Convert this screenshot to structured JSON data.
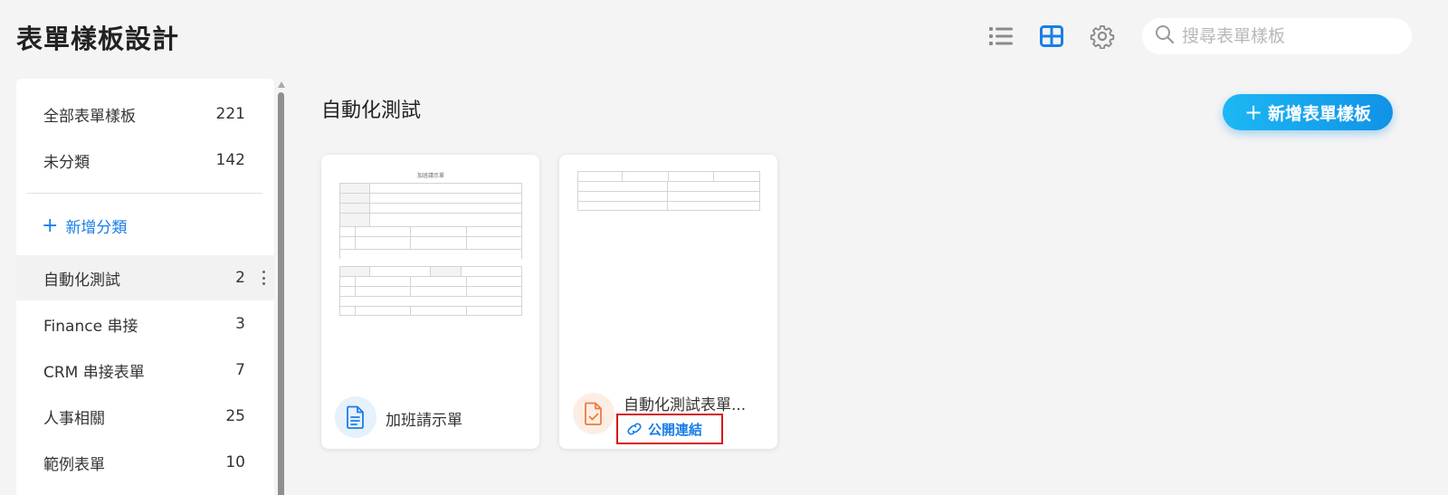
{
  "header": {
    "title": "表單樣板設計",
    "search_placeholder": "搜尋表單樣板",
    "icons": [
      "list-view-icon",
      "grid-view-icon",
      "gear-icon",
      "search-icon"
    ],
    "active_view_color": "#1a7ee8"
  },
  "sidebar": {
    "items": [
      {
        "label": "全部表單樣板",
        "count": "221"
      },
      {
        "label": "未分類",
        "count": "142"
      }
    ],
    "add_category_label": "新增分類",
    "categories": [
      {
        "label": "自動化測試",
        "count": "2"
      },
      {
        "label": "Finance 串接",
        "count": "3"
      },
      {
        "label": "CRM 串接表單",
        "count": "7"
      },
      {
        "label": "人事相關",
        "count": "25"
      },
      {
        "label": "範例表單",
        "count": "10"
      }
    ]
  },
  "main": {
    "section_title": "自動化測試",
    "add_button_label": "新增表單樣板",
    "cards": [
      {
        "name": "加班請示單",
        "preview_title": "加班請示單",
        "icon": "document-icon",
        "icon_color": "#1a7ee8",
        "icon_bg": "#e6f1fb"
      },
      {
        "name": "自動化測試表單...",
        "icon": "document-check-icon",
        "icon_color": "#f07a3a",
        "icon_bg": "#fdeee5",
        "link_label": "公開連結"
      }
    ]
  },
  "colors": {
    "accent": "#1a7ee8",
    "button_gradient_start": "#1cb8f4",
    "button_gradient_end": "#1192e6",
    "highlight_box": "#d4181e"
  }
}
